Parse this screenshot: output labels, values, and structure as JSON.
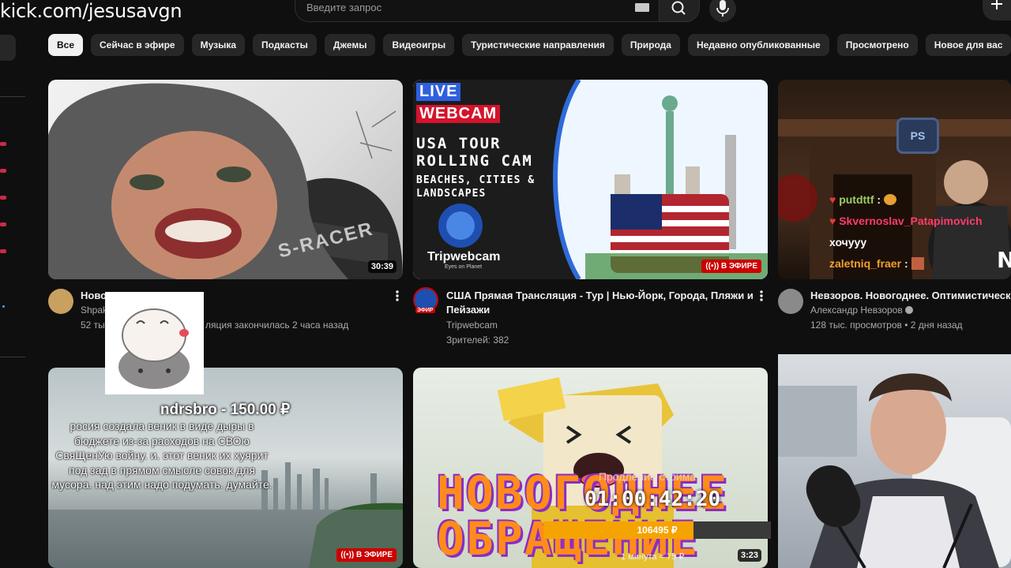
{
  "url": "kick.com/jesusavgn",
  "search": {
    "placeholder": "Введите запрос"
  },
  "chips": [
    {
      "label": "Все",
      "active": true
    },
    {
      "label": "Сейчас в эфире"
    },
    {
      "label": "Музыка"
    },
    {
      "label": "Подкасты"
    },
    {
      "label": "Джемы"
    },
    {
      "label": "Видеоигры"
    },
    {
      "label": "Туристические направления"
    },
    {
      "label": "Природа"
    },
    {
      "label": "Недавно опубликованные"
    },
    {
      "label": "Просмотрено"
    },
    {
      "label": "Новое для вас"
    }
  ],
  "videos": [
    {
      "title": "Ново",
      "channel": "Shpak",
      "stats": "52 ты",
      "stats_tail": "ляция закончилась 2 часа назад",
      "duration": "30:39",
      "thumb_text": "S-RACER"
    },
    {
      "title": "США Прямая Трансляция - Тур | Нью-Йорк, Города, Пляжи и Пейзажи",
      "channel": "Tripwebcam",
      "stats": "Зрителей: 382",
      "live_badge": "В ЭФИРЕ",
      "avatar_label": "ЭФИР",
      "thumb": {
        "live": "LIVE",
        "webcam": "WEBCAM",
        "line1": "USA TOUR",
        "line2": "ROLLING CAM",
        "line3": "BEACHES, CITIES &",
        "line4": "LANDSCAPES",
        "brand": "Tripwebcam",
        "brand_sub": "Eyes on Planet"
      }
    },
    {
      "title": "Невзоров. Новогоднее. Оптимистическ",
      "channel": "Александр Невзоров",
      "stats": "128 тыс. просмотров • 2 дня назад",
      "thumb_badge": "PS"
    },
    {
      "live_badge": "В ЭФИРЕ"
    },
    {
      "duration": "3:23",
      "thumb_text": "НОВОГОДНЕЕ ОБРАЩЕНИЕ"
    }
  ],
  "chat": [
    {
      "user": "putdttf",
      "color": "#9ccc65",
      "text": ":"
    },
    {
      "user": "Skvernoslav_Patapimovich",
      "color": "#ff3b6a",
      "text": ""
    },
    {
      "user": "",
      "color": "#ffffff",
      "text": "хочууу"
    },
    {
      "user": "zaletniq_fraer",
      "color": "#f0a030",
      "text": ":"
    }
  ],
  "donation": {
    "header": "ndrsbro - 150.00 ₽",
    "message": "росия создала веник в виде дыры в бюджете из-за расходов на СВОю СвяЩенУю войну. и. этот веник их хуярит под зад в прямом смысле совок для мусора. над этим надо подумать. думайте."
  },
  "stream": {
    "timer_label": "Продление стрима",
    "timer": "01:00:42:20",
    "goal_amount": "106495 ₽",
    "goal_fraction": 0.66,
    "rate": "1 минута = 75 ₽"
  },
  "colors": {
    "accent_live": "#cc0000",
    "goal": "#f5a300"
  }
}
